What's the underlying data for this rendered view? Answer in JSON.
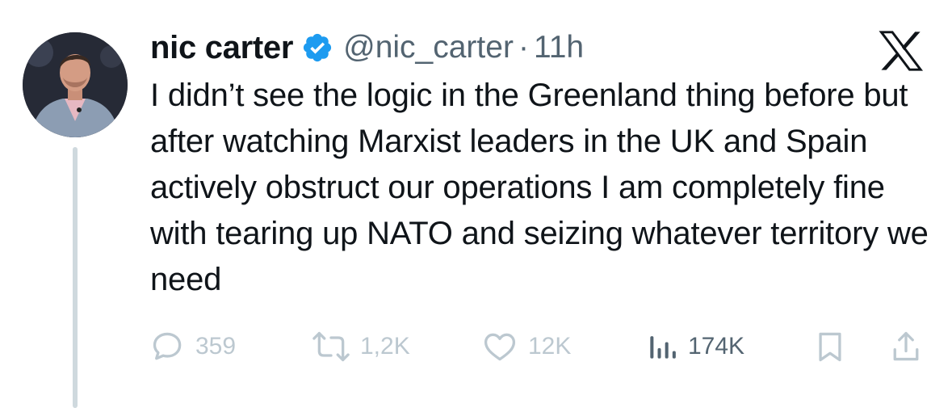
{
  "tweet": {
    "author_name": "nic carter",
    "handle": "@nic_carter",
    "separator": "·",
    "timestamp": "11h",
    "text": "I didn’t see the logic in the Greenland thing before but after watching Marxist leaders in the UK and Spain actively obstruct our operations I am completely fine with tearing up NATO and seizing whatever territory we need",
    "verified": true,
    "icons": {
      "verified": "verified-badge-icon",
      "platform": "x-logo-icon"
    },
    "actions": {
      "replies": "359",
      "reposts": "1,2K",
      "likes": "12K",
      "views": "174K"
    }
  },
  "colors": {
    "text": "#0f1419",
    "secondary": "#536471",
    "verified": "#1d9bf0",
    "faded_icons": "#bcc8d0",
    "thread_line": "#cfd9de"
  }
}
